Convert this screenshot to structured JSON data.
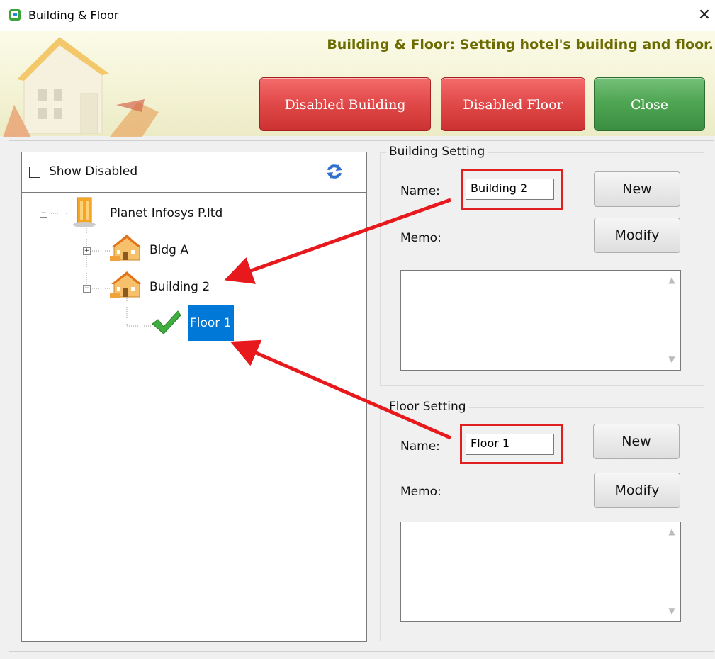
{
  "window": {
    "title": "Building & Floor",
    "close_symbol": "✕"
  },
  "banner": {
    "headline": "Building & Floor: Setting hotel's building and floor.",
    "buttons": {
      "disabled_building": "Disabled Building",
      "disabled_floor": "Disabled Floor",
      "close": "Close"
    },
    "colors": {
      "red_button": "#e24b4b",
      "green_button": "#4fa653",
      "headline": "#6b6b00"
    }
  },
  "tree": {
    "show_disabled_label": "Show Disabled",
    "show_disabled_checked": false,
    "root": {
      "label": "Planet Infosys P.ltd",
      "icon": "company-building-icon",
      "expanded": true
    },
    "children": [
      {
        "label": "Bldg A",
        "icon": "building-icon",
        "expanded": false
      },
      {
        "label": "Building 2",
        "icon": "building-icon",
        "expanded": true,
        "children": [
          {
            "label": "Floor 1",
            "icon": "checkmark-icon",
            "selected": true
          }
        ]
      }
    ],
    "selection_color": "#0078d7"
  },
  "building_setting": {
    "title": "Building Setting",
    "name_label": "Name:",
    "name_value": "Building 2",
    "memo_label": "Memo:",
    "new_label": "New",
    "modify_label": "Modify"
  },
  "floor_setting": {
    "title": "Floor Setting",
    "name_label": "Name:",
    "name_value": "Floor 1",
    "memo_label": "Memo:",
    "new_label": "New",
    "modify_label": "Modify"
  },
  "annotation": {
    "color": "#e8191c"
  }
}
